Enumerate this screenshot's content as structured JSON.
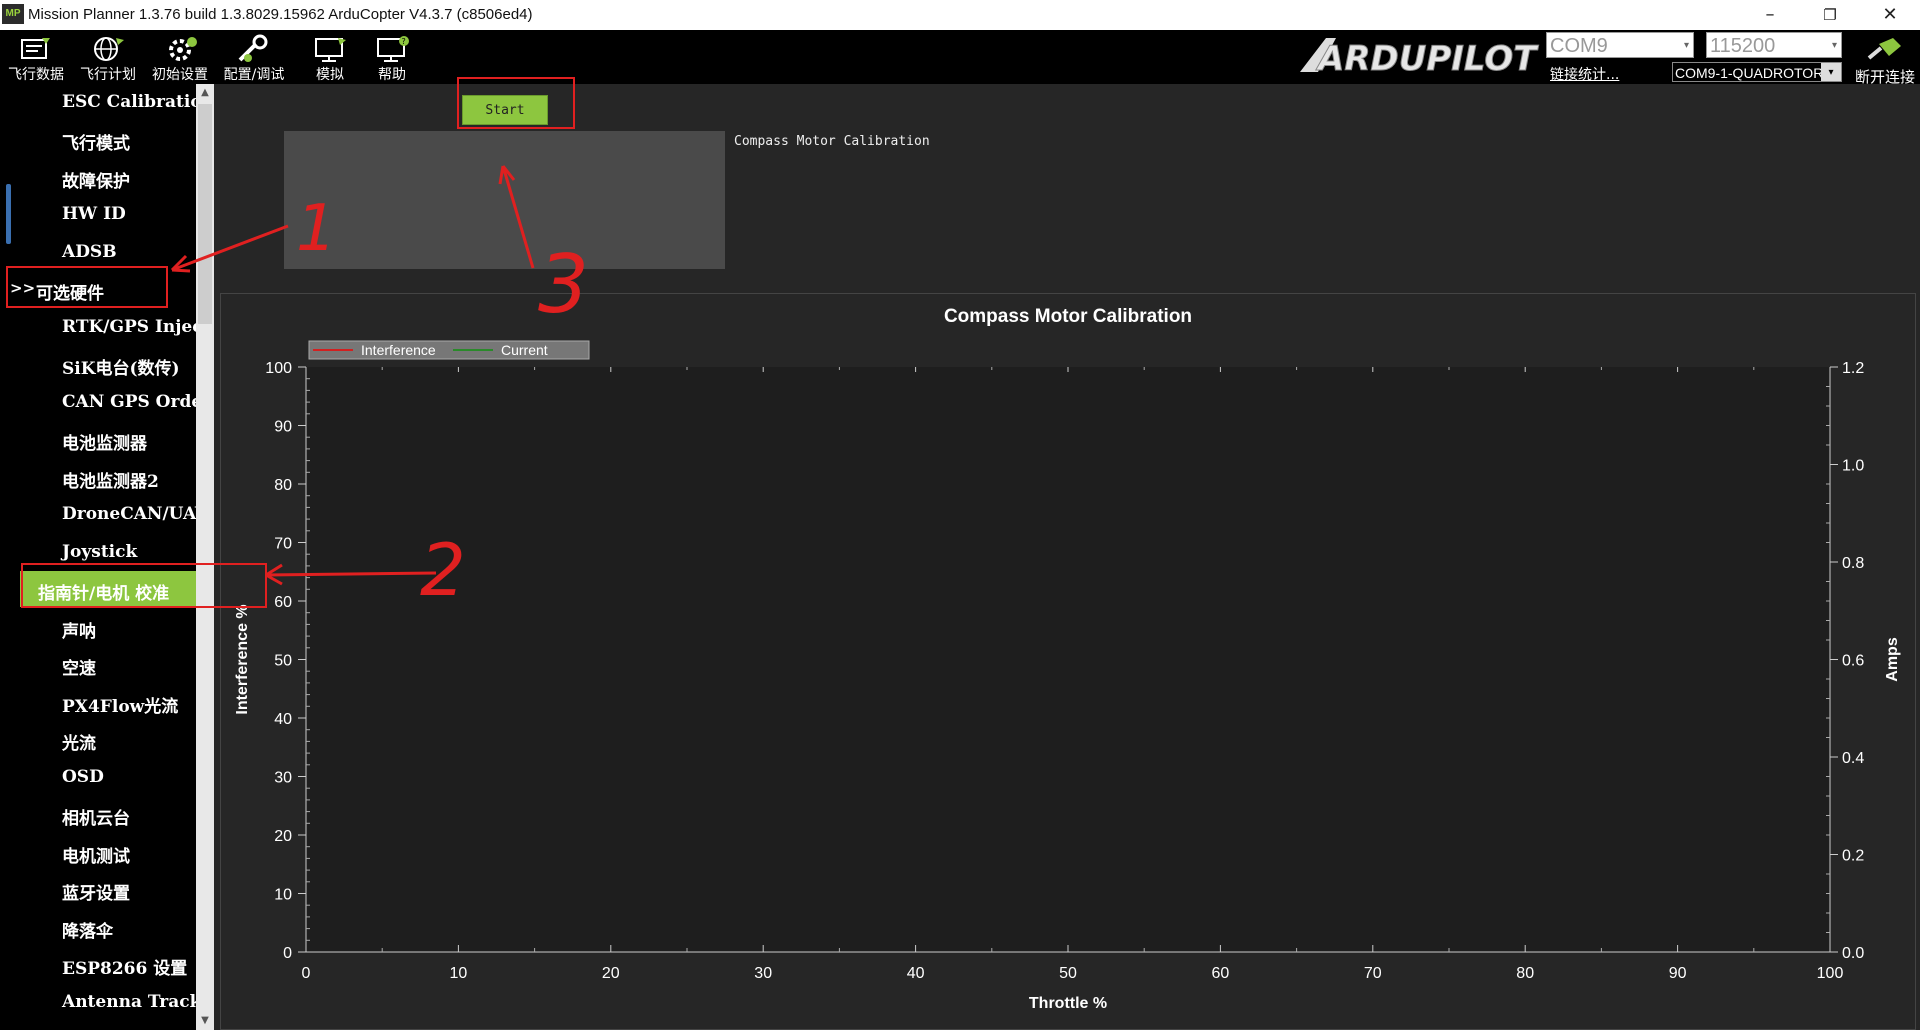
{
  "window": {
    "title": "Mission Planner 1.3.76 build 1.3.8029.15962 ArduCopter V4.3.7 (c8506ed4)",
    "app_icon": "MP",
    "controls": [
      "–",
      "❐",
      "✕"
    ]
  },
  "toolbar": {
    "items": [
      {
        "label": "飞行数据",
        "icon": "flight-data-icon"
      },
      {
        "label": "飞行计划",
        "icon": "flight-plan-icon"
      },
      {
        "label": "初始设置",
        "icon": "initial-setup-icon"
      },
      {
        "label": "配置/调试",
        "icon": "config-tuning-icon"
      },
      {
        "label": "模拟",
        "icon": "simulation-icon"
      },
      {
        "label": "帮助",
        "icon": "help-icon"
      }
    ],
    "logo": "ARDUPILOT",
    "port": "COM9",
    "baud": "115200",
    "link_stats": "链接统计...",
    "vehicle": "COM9-1-QUADROTOR",
    "disconnect_label": "断开连接"
  },
  "sidebar": {
    "items": [
      {
        "label": "ESC Calibration"
      },
      {
        "label": "飞行模式"
      },
      {
        "label": "故障保护"
      },
      {
        "label": "HW ID"
      },
      {
        "label": "ADSB"
      },
      {
        "label": "可选硬件"
      },
      {
        "label": "RTK/GPS Inject"
      },
      {
        "label": "SiK电台(数传)"
      },
      {
        "label": "CAN GPS Order"
      },
      {
        "label": "电池监测器"
      },
      {
        "label": "电池监测器2"
      },
      {
        "label": "DroneCAN/UAVCAN"
      },
      {
        "label": "Joystick"
      },
      {
        "label": "指南针/电机 校准"
      },
      {
        "label": "声呐"
      },
      {
        "label": "空速"
      },
      {
        "label": "PX4Flow光流"
      },
      {
        "label": "光流"
      },
      {
        "label": "OSD"
      },
      {
        "label": "相机云台"
      },
      {
        "label": "电机测试"
      },
      {
        "label": "蓝牙设置"
      },
      {
        "label": "降落伞"
      },
      {
        "label": "ESP8266 设置"
      },
      {
        "label": "Antenna Tracker"
      }
    ],
    "parent_chevron": ">>"
  },
  "main": {
    "start_label": "Start",
    "panel_label": "Compass Motor Calibration"
  },
  "chart_data": {
    "type": "line",
    "title": "Compass Motor Calibration",
    "xlabel": "Throttle %",
    "ylabel": "Interference %",
    "y2label": "Amps",
    "xlim": [
      0,
      100
    ],
    "ylim": [
      0,
      100
    ],
    "y2lim": [
      0.0,
      1.2
    ],
    "x_ticks": [
      "0",
      "10",
      "20",
      "30",
      "40",
      "50",
      "60",
      "70",
      "80",
      "90",
      "100"
    ],
    "y_ticks": [
      "0",
      "10",
      "20",
      "30",
      "40",
      "50",
      "60",
      "70",
      "80",
      "90",
      "100"
    ],
    "y2_ticks": [
      "0.0",
      "0.2",
      "0.4",
      "0.6",
      "0.8",
      "1.0",
      "1.2"
    ],
    "series": [
      {
        "name": "Interference",
        "color": "#d32020",
        "values": []
      },
      {
        "name": "Current",
        "color": "#2a8a2a",
        "values": []
      }
    ],
    "legend": "top-left",
    "grid": false
  },
  "annotations": {
    "labels": [
      "1",
      "2",
      "3"
    ],
    "color": "#e02020"
  },
  "colors": {
    "accent": "#8dc63f",
    "sidebar_bg": "#000000",
    "main_bg": "#262626",
    "chart_bg": "#1e1e1e"
  }
}
